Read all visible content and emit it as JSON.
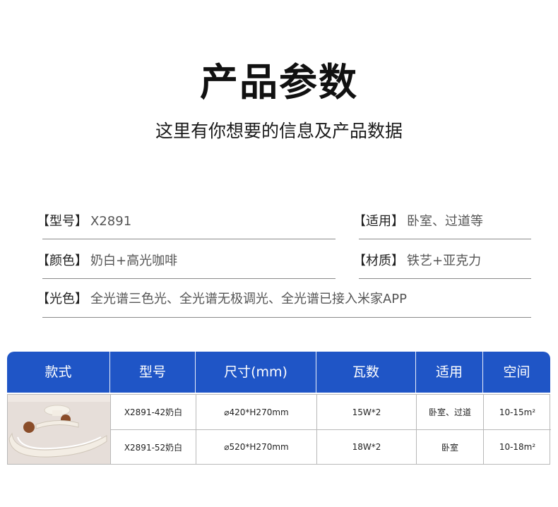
{
  "header": {
    "title": "产品参数",
    "subtitle": "这里有你想要的信息及产品数据"
  },
  "specs": {
    "model_label": "【型号】",
    "model_value": "X2891",
    "usage_label": "【适用】",
    "usage_value": "卧室、过道等",
    "color_label": "【颜色】",
    "color_value": "奶白+高光咖啡",
    "material_label": "【材质】",
    "material_value": "铁艺+亚克力",
    "light_label": "【光色】",
    "light_value": "全光谱三色光、全光谱无极调光、全光谱已接入米家APP"
  },
  "table": {
    "headers": [
      "款式",
      "型号",
      "尺寸(mm)",
      "瓦数",
      "适用",
      "空间"
    ],
    "rows": [
      {
        "model": "X2891-42奶白",
        "size": "⌀420*H270mm",
        "watt": "15W*2",
        "usage": "卧室、过道",
        "space": "10-15m²"
      },
      {
        "model": "X2891-52奶白",
        "size": "⌀520*H270mm",
        "watt": "18W*2",
        "usage": "卧室",
        "space": "10-18m²"
      }
    ]
  },
  "colors": {
    "header_blue": "#1f55c6",
    "lamp_cream": "#f3ede4",
    "wood_brown": "#8a4d2a"
  }
}
